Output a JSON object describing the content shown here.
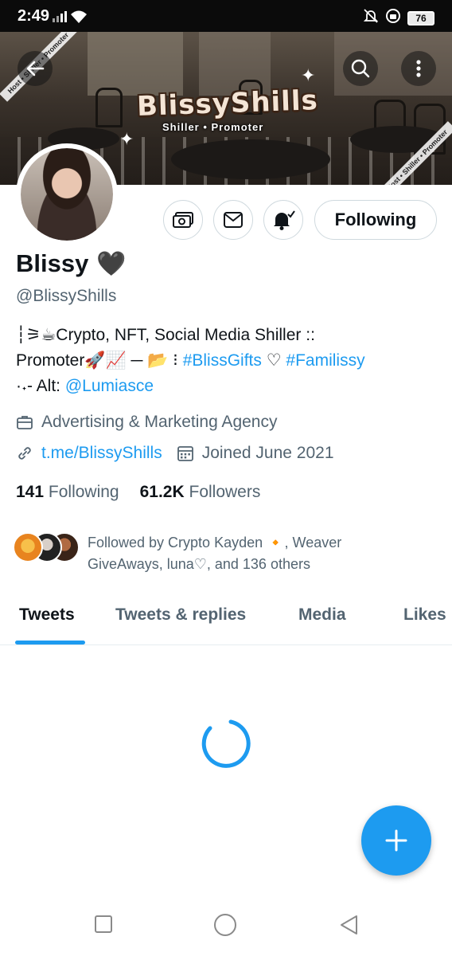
{
  "status_bar": {
    "time": "2:49",
    "battery": "76"
  },
  "banner": {
    "brand_title": "BlissyShills",
    "brand_subtitle": "Shiller • Promoter",
    "ribbon_top_left": "Host • Shiller • Promoter",
    "ribbon_bottom_right": "Host • Shiller • Promoter"
  },
  "profile": {
    "name": "Blissy",
    "name_emoji": "🖤",
    "handle": "@BlissyShills",
    "bio": {
      "line1": "┆⚞☕Crypto, NFT, Social Media Shiller ::",
      "line2_pre": "Promoter🚀📈 ─ 📂 ⁝ ",
      "tag1": "#BlissGifts",
      "line2_mid": " ♡ ",
      "tag2": "#Familissy",
      "line3_pre": "·˖- Alt: ",
      "mention": "@Lumiasce"
    },
    "category": "Advertising & Marketing Agency",
    "website": "t.me/BlissyShills",
    "joined": "Joined June 2021",
    "following_count": "141",
    "following_label": "Following",
    "followers_count": "61.2K",
    "followers_label": "Followers",
    "followed_by": "Followed by Crypto Kayden 🔸, Weaver GiveAways, luna♡, and 136 others"
  },
  "actions": {
    "follow_label": "Following"
  },
  "tabs": [
    {
      "label": "Tweets"
    },
    {
      "label": "Tweets & replies"
    },
    {
      "label": "Media"
    },
    {
      "label": "Likes"
    }
  ],
  "icons": {
    "back": "back-arrow-icon",
    "search": "search-icon",
    "more": "more-vertical-icon",
    "tip": "tip-money-icon",
    "message": "mail-icon",
    "notify": "bell-icon",
    "compose": "plus-icon"
  },
  "colors": {
    "accent": "#1d9bf0",
    "secondary_text": "#536471",
    "text": "#0f1419"
  }
}
